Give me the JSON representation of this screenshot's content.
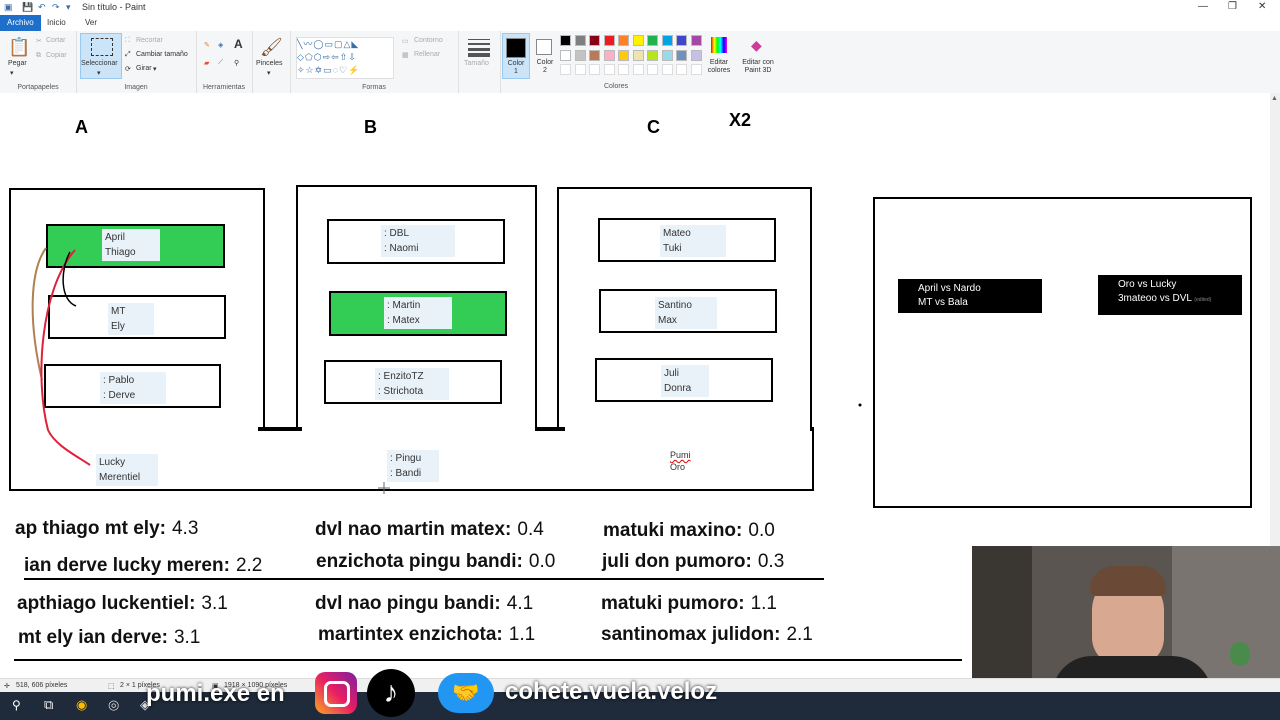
{
  "window": {
    "title": "Sin título - Paint"
  },
  "tabs": [
    {
      "label": "Archivo"
    },
    {
      "label": "Inicio"
    },
    {
      "label": "Ver"
    }
  ],
  "ribbon": {
    "portapapeles": {
      "pegar": "Pegar",
      "cortar": "Cortar",
      "copiar": "Copiar",
      "label": "Portapapeles"
    },
    "imagen": {
      "seleccionar": "Seleccionar",
      "recortar": "Recortar",
      "cambiar": "Cambiar tamaño",
      "girar": "Girar",
      "label": "Imagen"
    },
    "herramientas": {
      "label": "Herramientas"
    },
    "pinceles": {
      "label": "Pinceles"
    },
    "formas": {
      "contorno": "Contorno",
      "rellenar": "Rellenar",
      "label": "Formas"
    },
    "tamano": "Tamaño",
    "color1": "Color 1",
    "color2": "Color 2",
    "editar_colores": "Editar colores",
    "editar_paint3d": "Editar con Paint 3D",
    "colores_label": "Colores",
    "palette": [
      "#000000",
      "#7f7f7f",
      "#880015",
      "#ed1c24",
      "#ff7f27",
      "#fff200",
      "#22b14c",
      "#00a2e8",
      "#3f48cc",
      "#a349a4",
      "#ffffff",
      "#c3c3c3",
      "#b97a57",
      "#ffaec9",
      "#ffc90e",
      "#efe4b0",
      "#b5e61d",
      "#99d9ea",
      "#7092be",
      "#c8bfe7"
    ]
  },
  "canvas": {
    "groups": [
      {
        "letter": "A",
        "teams": [
          {
            "line1": "April",
            "line2": "Thiago",
            "highlight": true
          },
          {
            "line1": "MT",
            "line2": "Ely",
            "highlight": false
          },
          {
            "line1": ": Pablo",
            "line2": ": Derve",
            "highlight": false
          }
        ],
        "extra": {
          "line1": "Lucky",
          "line2": "Merentiel"
        }
      },
      {
        "letter": "B",
        "teams": [
          {
            "line1": ": DBL",
            "line2": ": Naomi",
            "highlight": false
          },
          {
            "line1": ": Martin",
            "line2": ": Matex",
            "highlight": true
          },
          {
            "line1": ": EnzitoTZ",
            "line2": ": Strichota",
            "highlight": false
          }
        ],
        "extra": {
          "line1": ": Pingu",
          "line2": ": Bandi"
        }
      },
      {
        "letter": "C",
        "teams": [
          {
            "line1": "Mateo",
            "line2": "Tuki",
            "highlight": false
          },
          {
            "line1": "Santino",
            "line2": "Max",
            "highlight": false
          },
          {
            "line1": "Juli",
            "line2": "Donra",
            "highlight": false
          }
        ],
        "extra": {
          "line1": "Pumi",
          "line2": "Oro"
        }
      }
    ],
    "x2_label": "X2",
    "matches": [
      {
        "line1": "April vs Nardo",
        "line2": "MT vs Bala",
        "note": ""
      },
      {
        "line1": "Oro vs Lucky",
        "line2": "3mateoo vs DVL",
        "note": "(edited)"
      }
    ],
    "odds": [
      {
        "label": "ap thiago mt ely:",
        "value": "4.3"
      },
      {
        "label": "dvl nao martin matex:",
        "value": "0.4"
      },
      {
        "label": "matuki maxino:",
        "value": "0.0"
      },
      {
        "label": "ian derve lucky meren:",
        "value": "2.2"
      },
      {
        "label": "enzichota pingu bandi:",
        "value": "0.0"
      },
      {
        "label": "juli don pumoro:",
        "value": "0.3"
      },
      {
        "label": "apthiago luckentiel:",
        "value": "3.1"
      },
      {
        "label": "dvl nao pingu bandi:",
        "value": "4.1"
      },
      {
        "label": "matuki pumoro:",
        "value": "1.1"
      },
      {
        "label": "mt ely ian derve:",
        "value": "3.1"
      },
      {
        "label": "martintex enzichota:",
        "value": "1.1"
      },
      {
        "label": "santinomax julidon:",
        "value": "2.1"
      }
    ]
  },
  "status": {
    "cursor": "518, 606 píxeles",
    "selection": "2 × 1 píxeles",
    "size": "1918 × 1090 píxeles"
  },
  "overlay": {
    "left_text": "pumi.exe en",
    "right_text": "cohete.vuela.veloz"
  }
}
